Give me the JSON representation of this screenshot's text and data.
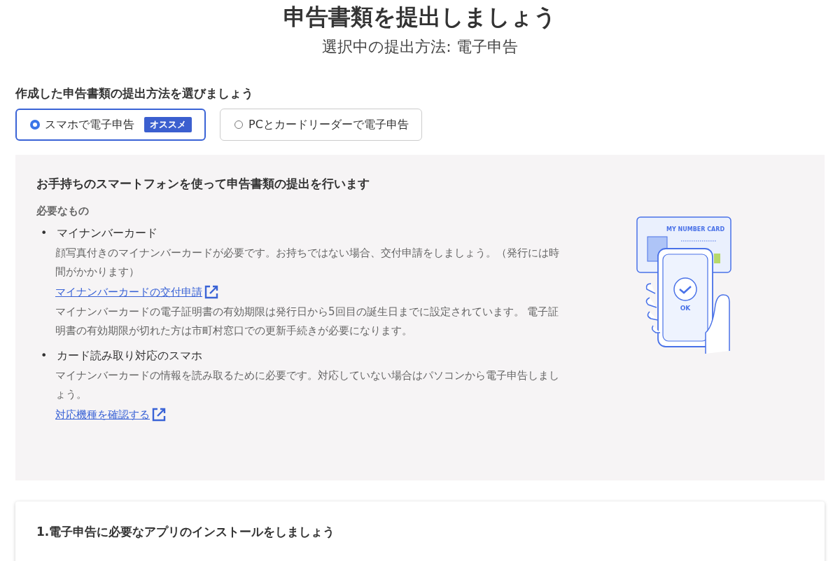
{
  "title": "申告書類を提出しましょう",
  "subtitle": "選択中の提出方法: 電子申告",
  "method_heading": "作成した申告書類の提出方法を選びましょう",
  "methods": [
    {
      "label": "スマホで電子申告",
      "badge": "オススメ",
      "selected": true
    },
    {
      "label": "PCとカードリーダーで電子申告",
      "selected": false
    }
  ],
  "panel": {
    "heading": "お手持ちのスマートフォンを使って申告書類の提出を行います",
    "subheading": "必要なもの",
    "items": [
      {
        "bullet": "•",
        "title": "マイナンバーカード",
        "blocks": [
          {
            "kind": "text",
            "text": "顔写真付きのマイナンバーカードが必要です。お持ちではない場合、交付申請をしましょう。（発行には時間がかかります）"
          },
          {
            "kind": "link",
            "text": "マイナンバーカードの交付申請"
          },
          {
            "kind": "text",
            "text": "マイナンバーカードの電子証明書の有効期限は発行日から5回目の誕生日までに設定されています。 電子証明書の有効期限が切れた方は市町村窓口での更新手続きが必要になります。"
          }
        ]
      },
      {
        "bullet": "•",
        "title": "カード読み取り対応のスマホ",
        "blocks": [
          {
            "kind": "text",
            "text": "マイナンバーカードの情報を読み取るために必要です。対応していない場合はパソコンから電子申告しましょう。"
          },
          {
            "kind": "link",
            "text": "対応機種を確認する"
          }
        ]
      }
    ],
    "illustration": {
      "card_label": "MY NUMBER CARD",
      "phone_label": "OK"
    }
  },
  "step_card": {
    "heading": "1.電子申告に必要なアプリのインストールをしましょう"
  }
}
